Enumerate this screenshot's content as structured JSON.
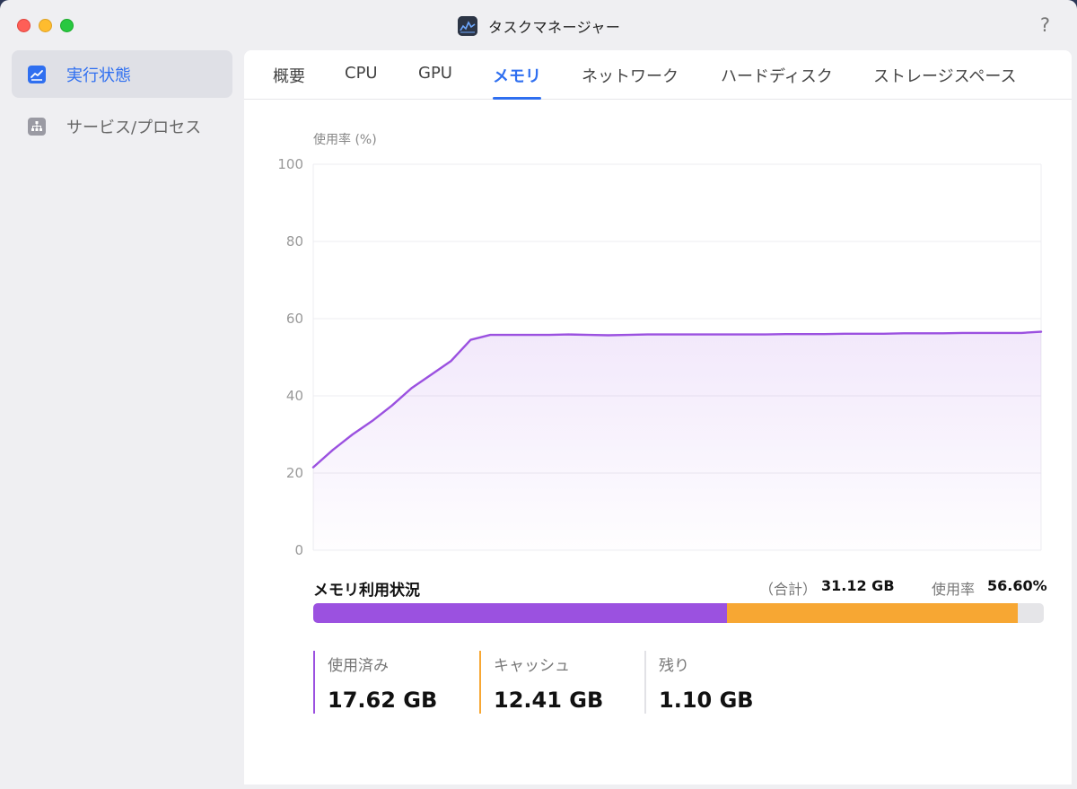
{
  "window": {
    "title": "タスクマネージャー",
    "help": "?"
  },
  "sidebar": {
    "items": [
      {
        "label": "実行状態",
        "icon": "chart-icon",
        "active": true
      },
      {
        "label": "サービス/プロセス",
        "icon": "hierarchy-icon",
        "active": false
      }
    ]
  },
  "tabs": [
    {
      "label": "概要",
      "active": false
    },
    {
      "label": "CPU",
      "active": false
    },
    {
      "label": "GPU",
      "active": false
    },
    {
      "label": "メモリ",
      "active": true
    },
    {
      "label": "ネットワーク",
      "active": false
    },
    {
      "label": "ハードディスク",
      "active": false
    },
    {
      "label": "ストレージスペース",
      "active": false
    }
  ],
  "chart_data": {
    "type": "area",
    "ylabel": "使用率 (%)",
    "ylim": [
      0,
      100
    ],
    "yticks": [
      "0",
      "20",
      "40",
      "60",
      "80",
      "100"
    ],
    "grid": true,
    "line_color": "#9b51e0",
    "values": [
      21.5,
      26,
      30,
      33.5,
      37.5,
      42,
      45.5,
      49,
      54.5,
      55.8,
      55.8,
      55.8,
      55.8,
      55.9,
      55.8,
      55.7,
      55.8,
      55.9,
      55.9,
      55.9,
      55.9,
      55.9,
      55.9,
      55.9,
      56,
      56,
      56,
      56.1,
      56.1,
      56.1,
      56.2,
      56.2,
      56.2,
      56.3,
      56.3,
      56.3,
      56.3,
      56.6
    ]
  },
  "memory": {
    "title": "メモリ利用状況",
    "total_label": "（合計）",
    "total_value": "31.12 GB",
    "rate_label": "使用率",
    "rate_value": "56.60%",
    "used_fraction": 0.566,
    "cache_fraction": 0.3988,
    "colors": {
      "used": "#9b51e0",
      "cache": "#f7a733",
      "free": "#e5e5e8"
    },
    "legend": [
      {
        "label": "使用済み",
        "value": "17.62 GB",
        "color": "#9b51e0"
      },
      {
        "label": "キャッシュ",
        "value": "12.41 GB",
        "color": "#f7a733"
      },
      {
        "label": "残り",
        "value": "1.10 GB",
        "color": "#e2e2e6"
      }
    ]
  }
}
